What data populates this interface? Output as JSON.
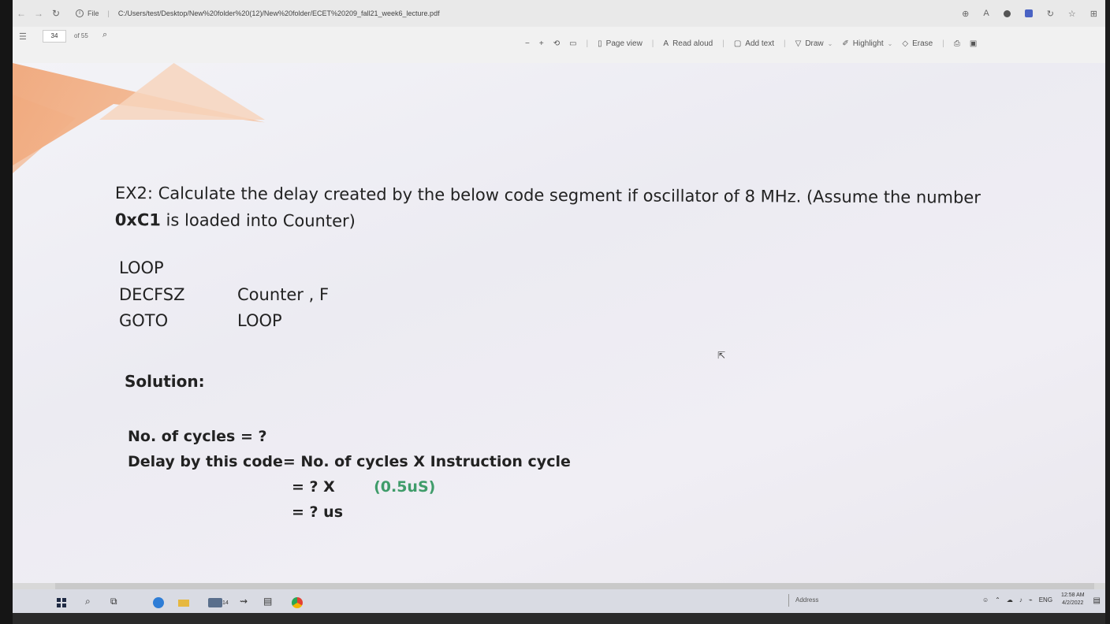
{
  "browser": {
    "file_label": "File",
    "url": "C:/Users/test/Desktop/New%20folder%20(12)/New%20folder/ECET%20209_fall21_week6_lecture.pdf",
    "icons": [
      "back-icon",
      "forward-icon",
      "refresh-icon",
      "info-icon",
      "zoom-icon",
      "read-aloud-icon",
      "profile-dot-icon",
      "extension-icon",
      "favorites-icon",
      "collections-icon"
    ]
  },
  "pdf_toolbar": {
    "page_number": "34",
    "page_total": "of 55",
    "zoom_out": "−",
    "zoom_in": "+",
    "page_view": "Page view",
    "read_aloud": "Read aloud",
    "add_text": "Add text",
    "draw": "Draw",
    "highlight": "Highlight",
    "erase": "Erase"
  },
  "document": {
    "question_line1": "EX2: Calculate the delay created by the below code segment if oscillator of 8 MHz. (Assume the number",
    "question_bold": "0xC1",
    "question_line2_rest": " is loaded into Counter)",
    "code": [
      {
        "op": "LOOP",
        "arg": ""
      },
      {
        "op": "DECFSZ",
        "arg": "Counter , F"
      },
      {
        "op": "GOTO",
        "arg": "LOOP"
      }
    ],
    "solution_label": "Solution:",
    "calc_line1": "No. of cycles = ?",
    "calc_line2": "Delay by this code= No. of cycles X Instruction cycle",
    "calc_line3_a": "= ?  X",
    "calc_line3_b": "(0.5uS)",
    "calc_line4": "= ? us"
  },
  "taskbar": {
    "address_label": "Address",
    "language": "ENG",
    "time": "12:58 AM",
    "date": "4/2/2022",
    "mail_badge": "14"
  }
}
